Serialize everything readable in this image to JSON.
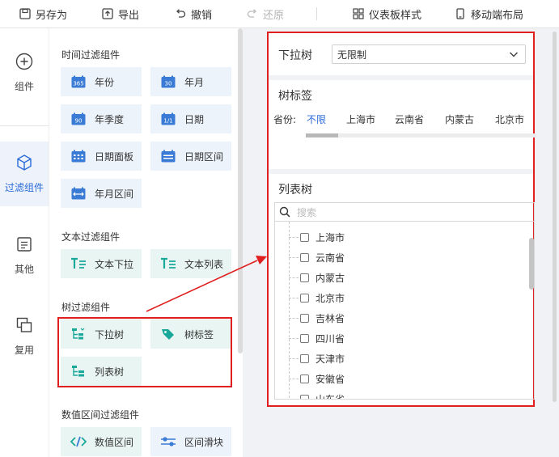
{
  "toolbar": {
    "save_as": "另存为",
    "export": "导出",
    "undo": "撤销",
    "redo": "还原",
    "dashboard_style": "仪表板样式",
    "mobile_layout": "移动端布局"
  },
  "leftnav": {
    "components": "组件",
    "filter_components": "过滤组件",
    "other": "其他",
    "reuse": "复用"
  },
  "panel": {
    "time_section": "时间过滤组件",
    "time_items": [
      "年份",
      "年月",
      "年季度",
      "日期",
      "日期面板",
      "日期区间",
      "年月区间"
    ],
    "time_icon_numbers": [
      "365",
      "30",
      "90",
      "1/1"
    ],
    "text_section": "文本过滤组件",
    "text_items": [
      "文本下拉",
      "文本列表"
    ],
    "tree_section": "树过滤组件",
    "tree_items": [
      "下拉树",
      "树标签",
      "列表树"
    ],
    "numeric_section": "数值区间过滤组件",
    "numeric_items": [
      "数值区间",
      "区间滑块"
    ]
  },
  "preview": {
    "dropdown_tree": {
      "label": "下拉树",
      "value": "无限制"
    },
    "tree_tag": {
      "title": "树标签",
      "field_label": "省份:",
      "tags": [
        "不限",
        "上海市",
        "云南省",
        "内蒙古",
        "北京市"
      ],
      "active_tag": "不限"
    },
    "list_tree": {
      "title": "列表树",
      "search_placeholder": "搜索",
      "items": [
        "上海市",
        "云南省",
        "内蒙古",
        "北京市",
        "吉林省",
        "四川省",
        "天津市",
        "安徽省",
        "山东省"
      ]
    }
  },
  "colors": {
    "accent": "#2a6ad8",
    "highlight_border": "#e02020",
    "time_icon": "#3a7bd5",
    "teal_icon": "#1aa89a"
  }
}
